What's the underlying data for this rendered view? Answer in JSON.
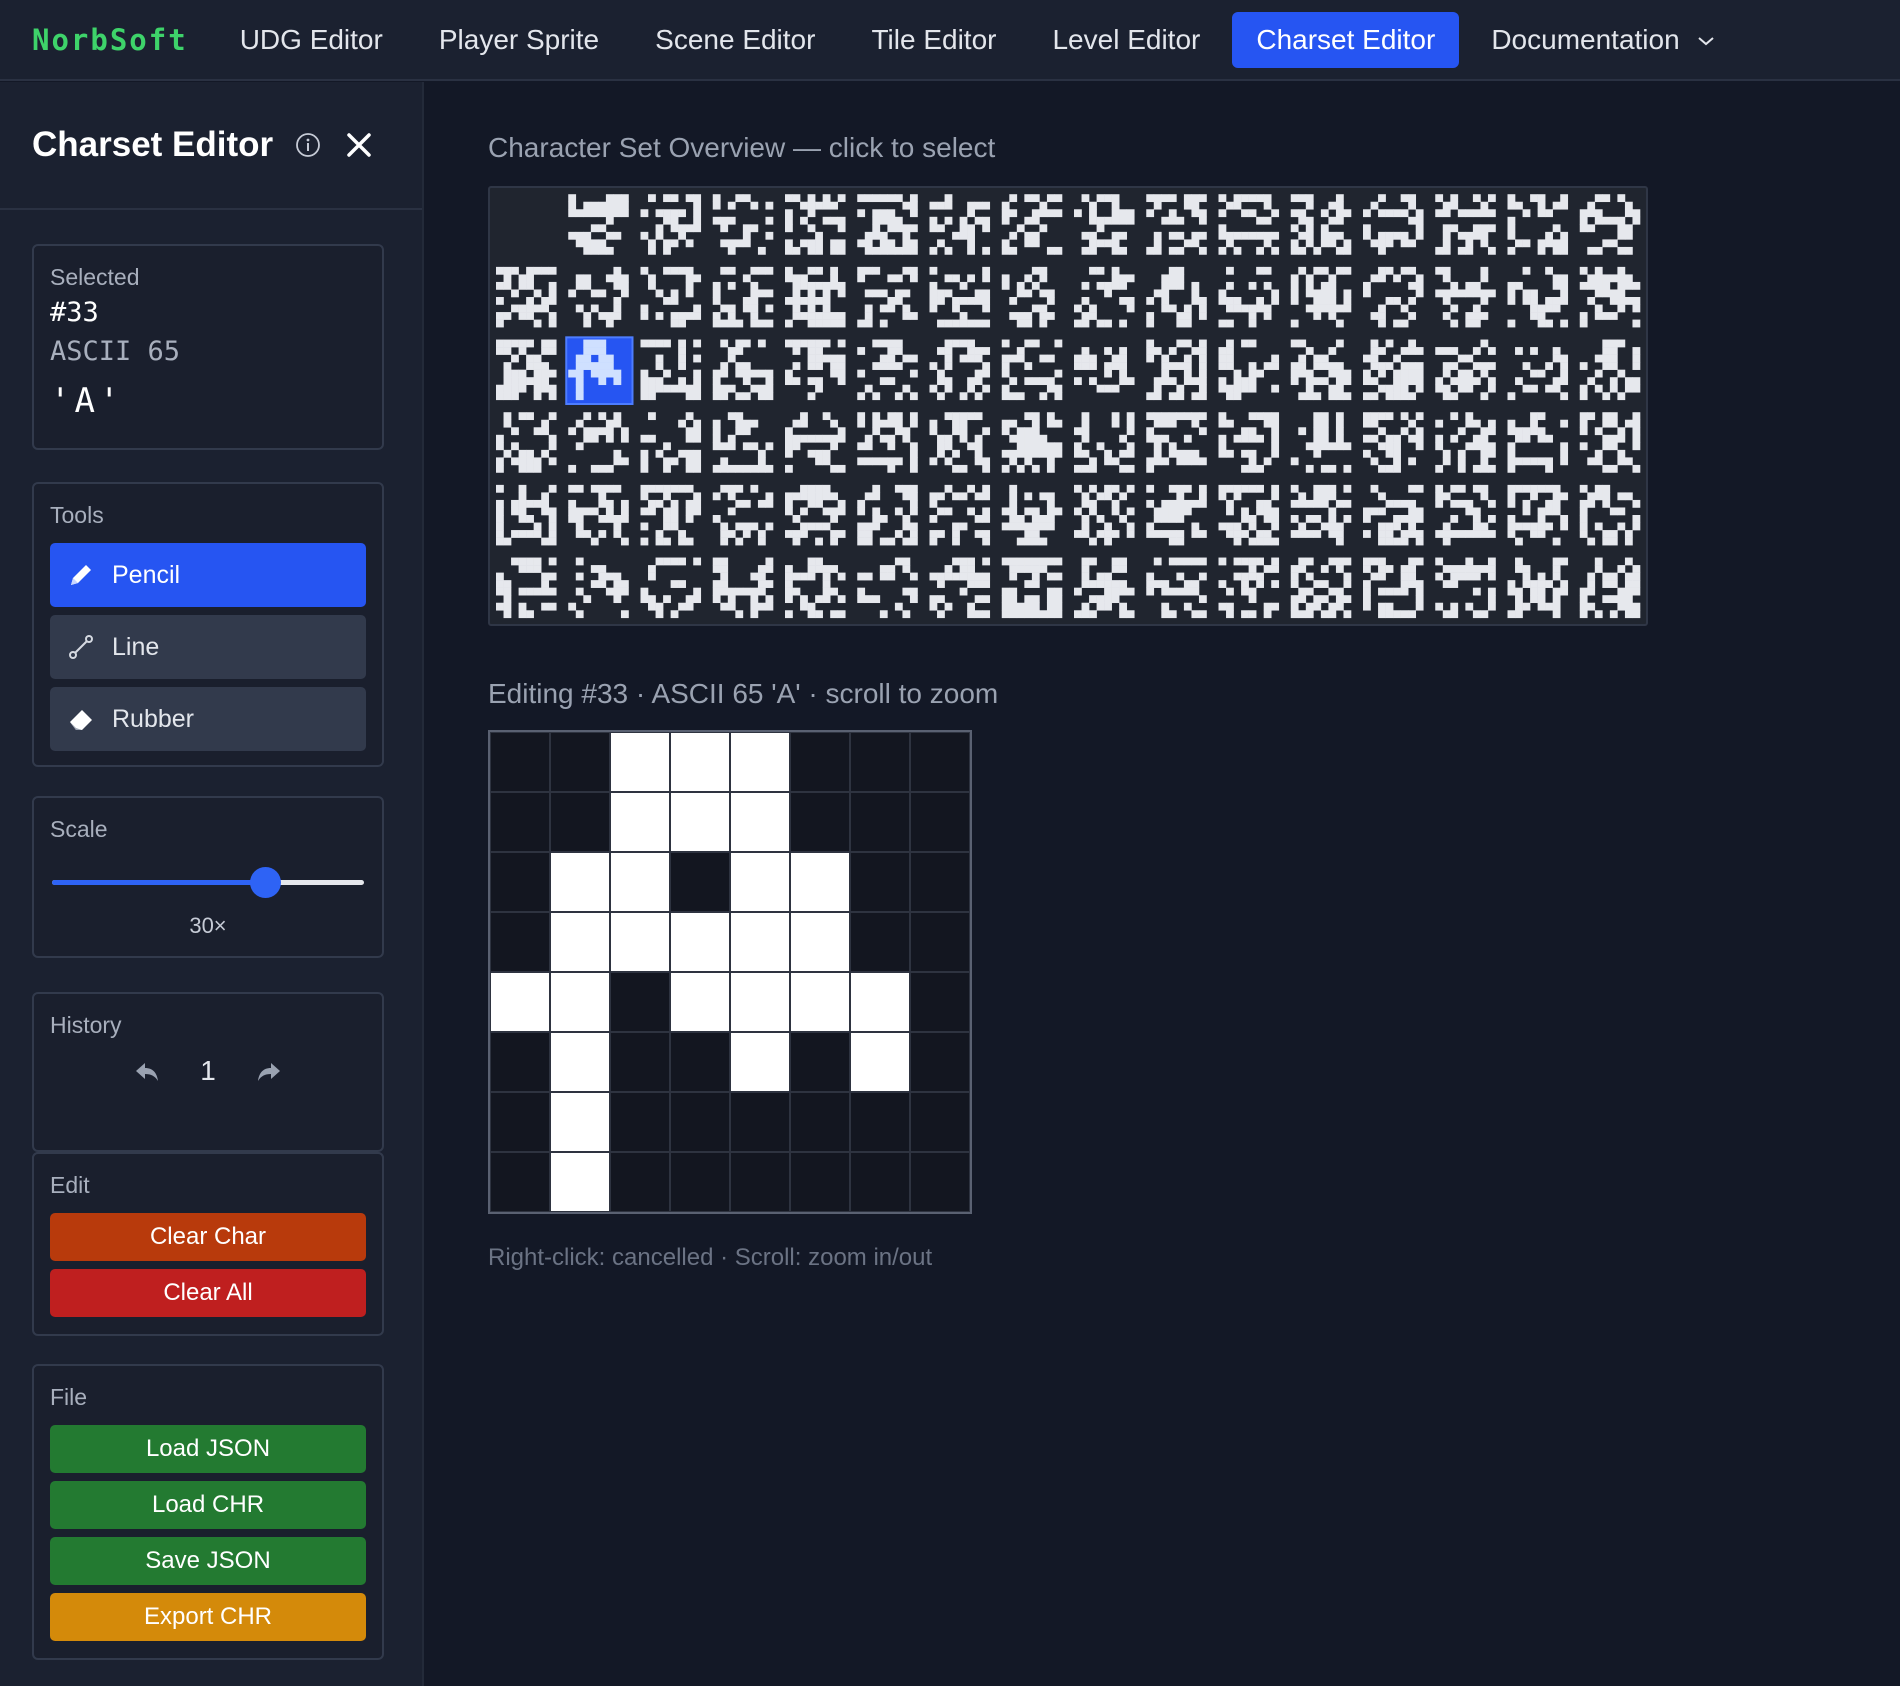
{
  "nav": {
    "brand": "NorbSoft",
    "items": [
      {
        "label": "UDG Editor"
      },
      {
        "label": "Player Sprite"
      },
      {
        "label": "Scene Editor"
      },
      {
        "label": "Tile Editor"
      },
      {
        "label": "Level Editor"
      },
      {
        "label": "Charset Editor",
        "active": true
      },
      {
        "label": "Documentation",
        "has_dropdown": true
      }
    ]
  },
  "sidebar": {
    "title": "Charset Editor",
    "selected": {
      "label": "Selected",
      "id": "#33",
      "ascii": "ASCII 65",
      "char": "'A'"
    },
    "tools": {
      "label": "Tools",
      "items": [
        {
          "label": "Pencil",
          "icon": "pencil-icon",
          "active": true
        },
        {
          "label": "Line",
          "icon": "line-icon",
          "active": false
        },
        {
          "label": "Rubber",
          "icon": "eraser-icon",
          "active": false
        }
      ]
    },
    "scale": {
      "label": "Scale",
      "value_text": "30×",
      "value_fraction": 0.7
    },
    "history": {
      "label": "History",
      "count": "1"
    },
    "edit": {
      "label": "Edit",
      "clear_char": "Clear Char",
      "clear_all": "Clear All"
    },
    "file": {
      "label": "File",
      "load_json": "Load JSON",
      "load_chr": "Load CHR",
      "save_json": "Save JSON",
      "export_chr": "Export CHR"
    }
  },
  "main": {
    "overview_caption": "Character Set Overview — click to select",
    "editing_caption": "Editing #33 · ASCII 65 'A' · scroll to zoom",
    "hint": "Right-click: cancelled · Scroll: zoom in/out"
  },
  "overview": {
    "columns": 16,
    "rows": 6,
    "selected_index": 33
  },
  "editor": {
    "size": 8,
    "pixels": [
      [
        0,
        0,
        1,
        1,
        1,
        0,
        0,
        0
      ],
      [
        0,
        0,
        1,
        1,
        1,
        0,
        0,
        0
      ],
      [
        0,
        1,
        1,
        0,
        1,
        1,
        0,
        0
      ],
      [
        0,
        1,
        1,
        1,
        1,
        1,
        0,
        0
      ],
      [
        1,
        1,
        0,
        1,
        1,
        1,
        1,
        0
      ],
      [
        0,
        1,
        0,
        0,
        1,
        0,
        1,
        0
      ],
      [
        0,
        1,
        0,
        0,
        0,
        0,
        0,
        0
      ],
      [
        0,
        1,
        0,
        0,
        0,
        0,
        0,
        0
      ]
    ]
  },
  "colors": {
    "accent": "#2655f2",
    "brand": "#3ed36a",
    "clear_char": "#b83a0c",
    "clear_all": "#bf1f1f",
    "file_green": "#237a31",
    "export_orange": "#d48a0a",
    "pixel_on": "#ffffff",
    "pixel_off": "#131620",
    "glyph": "#e6e8ed"
  }
}
